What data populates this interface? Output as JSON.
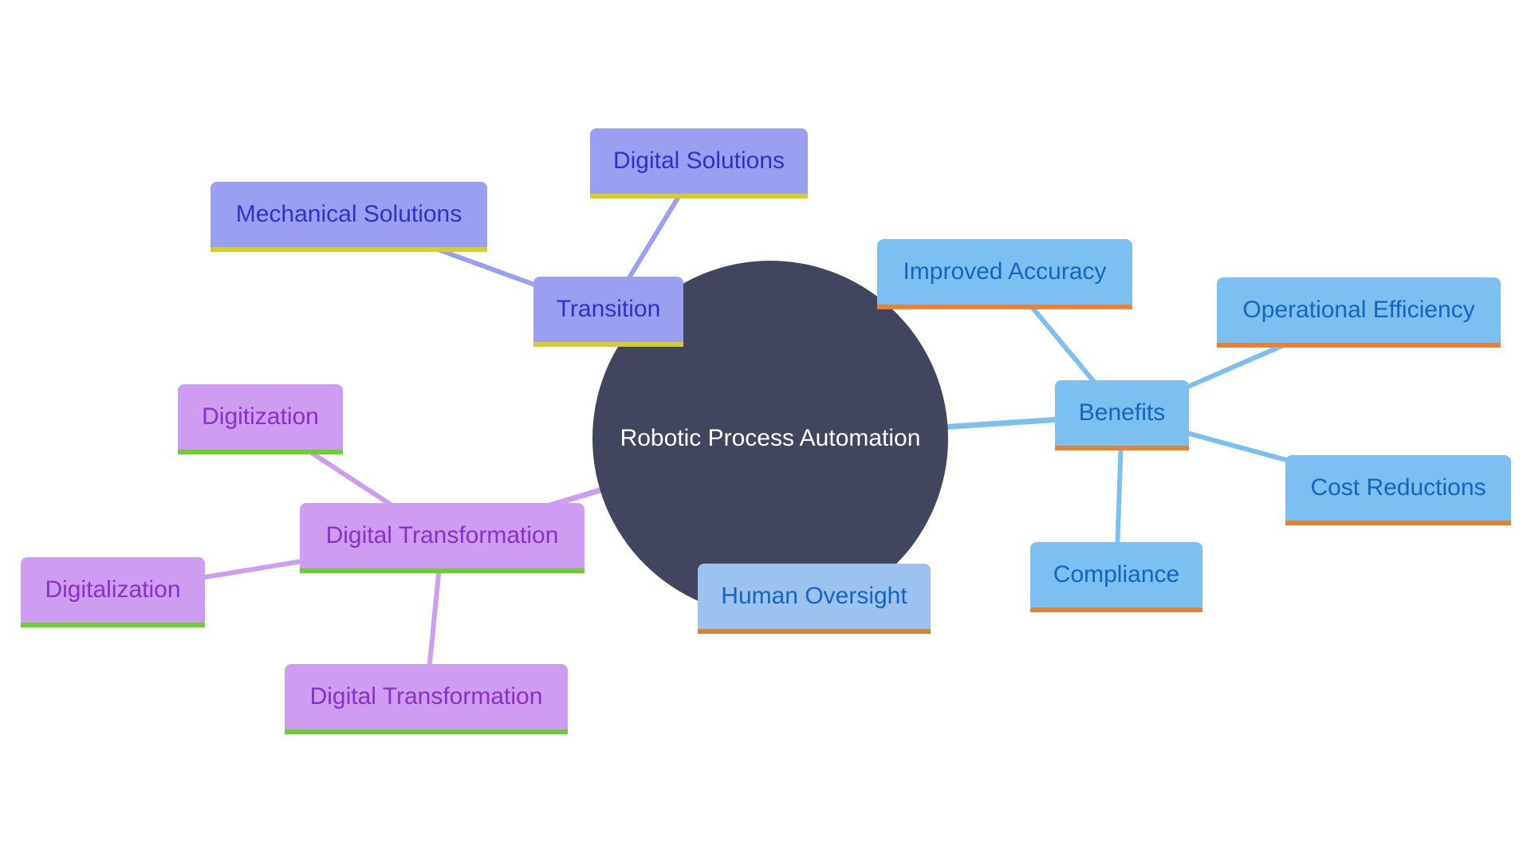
{
  "title": "Robotic Process Automation mind map",
  "colors": {
    "root_fill": "#41455d",
    "root_text": "#ffffff",
    "transition_fill": "#9b9ff2",
    "transition_text": "#3131c8",
    "transition_underline": "#d6cf22",
    "transition_edge": "#9b9ff2",
    "benefits_fill": "#7bc0f0",
    "benefits_text": "#1565c0",
    "benefits_underline": "#e88233",
    "benefits_edge": "#7bc0f0",
    "oversight_fill": "#9cc3f0",
    "oversight_underline": "#d8822b",
    "digital_fill": "#ce9df2",
    "digital_text": "#8a2fc8",
    "digital_underline": "#6ad02a",
    "digital_edge": "#ce9df2"
  },
  "root": {
    "id": "rpa",
    "label": "Robotic Process Automation"
  },
  "nodes": [
    {
      "id": "transition",
      "label": "Transition",
      "group": "transition",
      "parent": "rpa"
    },
    {
      "id": "mechanical",
      "label": "Mechanical Solutions",
      "group": "transition",
      "parent": "transition"
    },
    {
      "id": "digital-solutions",
      "label": "Digital Solutions",
      "group": "transition",
      "parent": "transition"
    },
    {
      "id": "benefits",
      "label": "Benefits",
      "group": "benefits",
      "parent": "rpa"
    },
    {
      "id": "improved-accuracy",
      "label": "Improved Accuracy",
      "group": "benefits",
      "parent": "benefits"
    },
    {
      "id": "operational-efficiency",
      "label": "Operational Efficiency",
      "group": "benefits",
      "parent": "benefits"
    },
    {
      "id": "cost-reductions",
      "label": "Cost Reductions",
      "group": "benefits",
      "parent": "benefits"
    },
    {
      "id": "compliance",
      "label": "Compliance",
      "group": "benefits",
      "parent": "benefits"
    },
    {
      "id": "human-oversight",
      "label": "Human Oversight",
      "group": "oversight",
      "parent": "rpa"
    },
    {
      "id": "digital-transformation",
      "label": "Digital Transformation",
      "group": "digital",
      "parent": "rpa"
    },
    {
      "id": "digitization",
      "label": "Digitization",
      "group": "digital",
      "parent": "digital-transformation"
    },
    {
      "id": "digitalization",
      "label": "Digitalization",
      "group": "digital",
      "parent": "digital-transformation"
    },
    {
      "id": "digital-transformation-2",
      "label": "Digital Transformation",
      "group": "digital",
      "parent": "digital-transformation"
    }
  ]
}
